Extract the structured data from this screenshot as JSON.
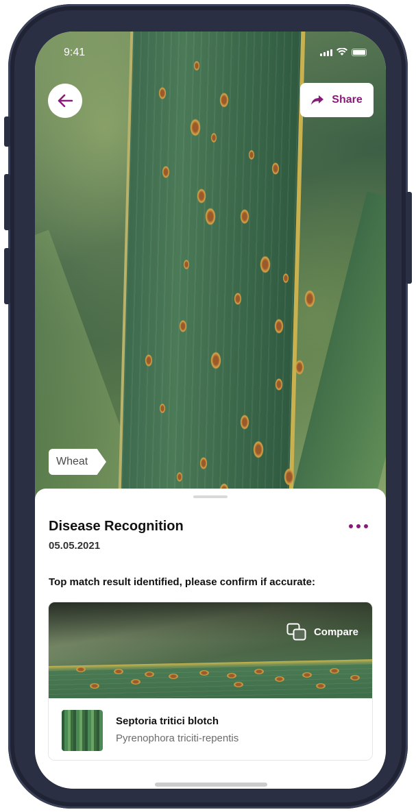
{
  "status_bar": {
    "time": "9:41"
  },
  "header": {
    "back_icon": "arrow-left-icon",
    "share_label": "Share",
    "share_icon": "share-arrow-icon"
  },
  "photo": {
    "crop_tag": "Wheat"
  },
  "sheet": {
    "title": "Disease Recognition",
    "date": "05.05.2021",
    "more_icon": "more-horizontal-icon",
    "prompt": "Top match result identified, please confirm if accurate:",
    "result": {
      "compare_label": "Compare",
      "compare_icon": "copy-compare-icon",
      "disease_name": "Septoria tritici blotch",
      "pathogen": "Pyrenophora triciti-repentis"
    }
  },
  "colors": {
    "accent": "#8a1a7a",
    "phone_frame": "#2a2f43",
    "text_primary": "#111111",
    "text_secondary": "#6b6b6b"
  }
}
